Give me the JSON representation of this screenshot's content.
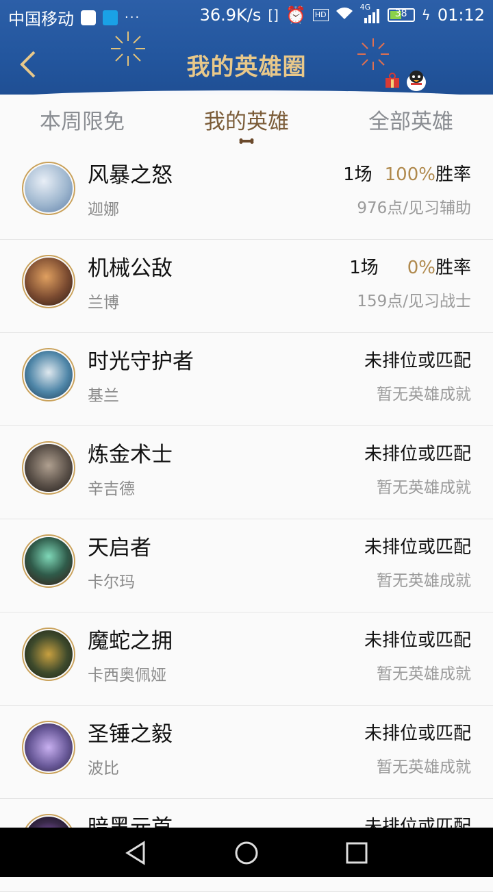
{
  "status_bar": {
    "carrier": "中国移动",
    "speed": "36.9K/s",
    "hd_label": "HD",
    "network": "4G",
    "battery": "38",
    "time": "01:12",
    "icons": [
      "qq-icon",
      "app-notification-icon",
      "more-icon",
      "vibrate-icon",
      "alarm-icon",
      "hd-icon",
      "wifi-icon",
      "signal-icon",
      "battery-icon",
      "charging-icon"
    ]
  },
  "header": {
    "title": "我的英雄圈",
    "back_icon": "chevron-left-icon",
    "colors": {
      "bg": "#23569e",
      "title": "#e8c88a"
    }
  },
  "tabs": [
    {
      "label": "本周限免",
      "active": false
    },
    {
      "label": "我的英雄",
      "active": true
    },
    {
      "label": "全部英雄",
      "active": false
    }
  ],
  "heroes": [
    {
      "title": "风暴之怒",
      "name": "迦娜",
      "games": "1场",
      "rate": "100%",
      "rate_suffix": "胜率",
      "sub": "976点/见习辅助",
      "avatar_color": "#9fb7cf"
    },
    {
      "title": "机械公敌",
      "name": "兰博",
      "games": "1场",
      "rate": "0%",
      "rate_suffix": "胜率",
      "sub": "159点/见习战士",
      "avatar_color": "#7a4a30"
    },
    {
      "title": "时光守护者",
      "name": "基兰",
      "status": "未排位或匹配",
      "sub": "暂无英雄成就",
      "avatar_color": "#4f86a8"
    },
    {
      "title": "炼金术士",
      "name": "辛吉德",
      "status": "未排位或匹配",
      "sub": "暂无英雄成就",
      "avatar_color": "#5a5048"
    },
    {
      "title": "天启者",
      "name": "卡尔玛",
      "status": "未排位或匹配",
      "sub": "暂无英雄成就",
      "avatar_color": "#2f5b4a"
    },
    {
      "title": "魔蛇之拥",
      "name": "卡西奥佩娅",
      "status": "未排位或匹配",
      "sub": "暂无英雄成就",
      "avatar_color": "#3e4a2c"
    },
    {
      "title": "圣锤之毅",
      "name": "波比",
      "status": "未排位或匹配",
      "sub": "暂无英雄成就",
      "avatar_color": "#6a5a9a"
    },
    {
      "title": "暗黑元首",
      "name": "",
      "status": "未排位或匹配",
      "sub": "",
      "avatar_color": "#3a2a4a"
    }
  ],
  "nav": [
    "back-nav-icon",
    "home-nav-icon",
    "recent-apps-icon"
  ]
}
